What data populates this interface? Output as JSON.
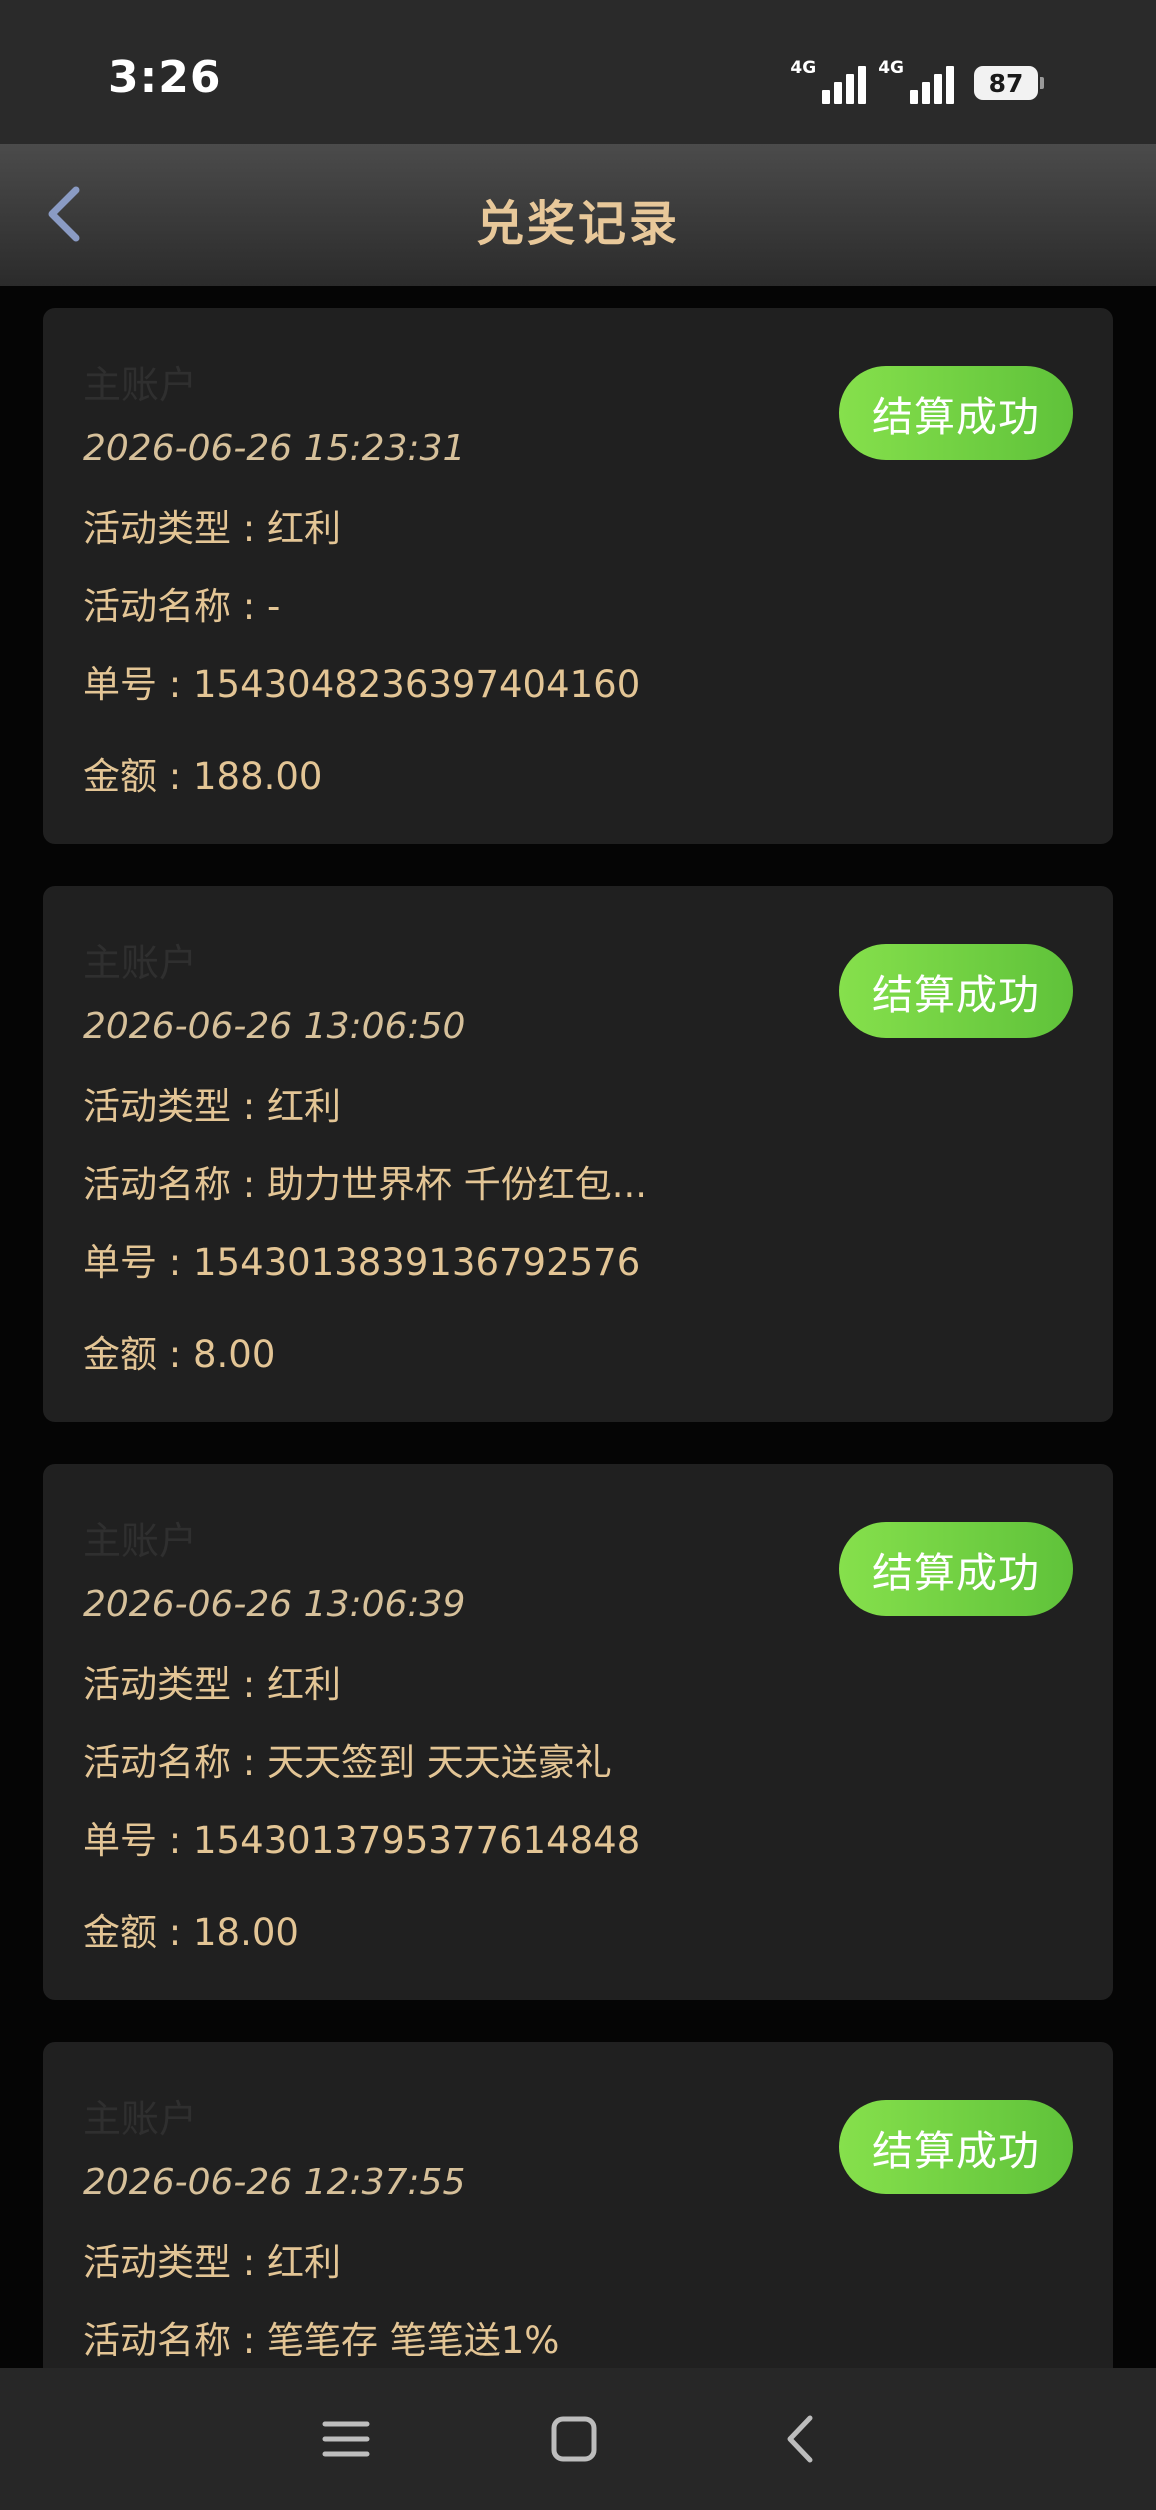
{
  "status_bar": {
    "time": "3:26",
    "network_1": "4G",
    "network_2": "4G",
    "battery": "87"
  },
  "header": {
    "title": "兑奖记录"
  },
  "records": [
    {
      "account": "主账户",
      "datetime": "2026-06-26 15:23:31",
      "type": "活动类型 : 红利",
      "name": "活动名称 : -",
      "order": "单号 : 1543048236397404160",
      "amount": "金额 : 188.00",
      "status": "结算成功"
    },
    {
      "account": "主账户",
      "datetime": "2026-06-26 13:06:50",
      "type": "活动类型 : 红利",
      "name": "活动名称 : 助力世界杯 千份红包...",
      "order": "单号 : 1543013839136792576",
      "amount": "金额 : 8.00",
      "status": "结算成功"
    },
    {
      "account": "主账户",
      "datetime": "2026-06-26 13:06:39",
      "type": "活动类型 : 红利",
      "name": "活动名称 : 天天签到 天天送豪礼",
      "order": "单号 : 1543013795377614848",
      "amount": "金额 : 18.00",
      "status": "结算成功"
    },
    {
      "account": "主账户",
      "datetime": "2026-06-26 12:37:55",
      "type": "活动类型 : 红利",
      "name": "活动名称 : 笔笔存 笔笔送1%",
      "order": "",
      "amount": "",
      "status": "结算成功"
    }
  ],
  "nav": {
    "icons": [
      "menu-icon",
      "home-icon",
      "back-icon"
    ]
  },
  "colors": {
    "accent_gold": "#e3c595",
    "status_green": "#6ccf3f",
    "card_bg": "#202020",
    "page_bg": "#050505"
  }
}
